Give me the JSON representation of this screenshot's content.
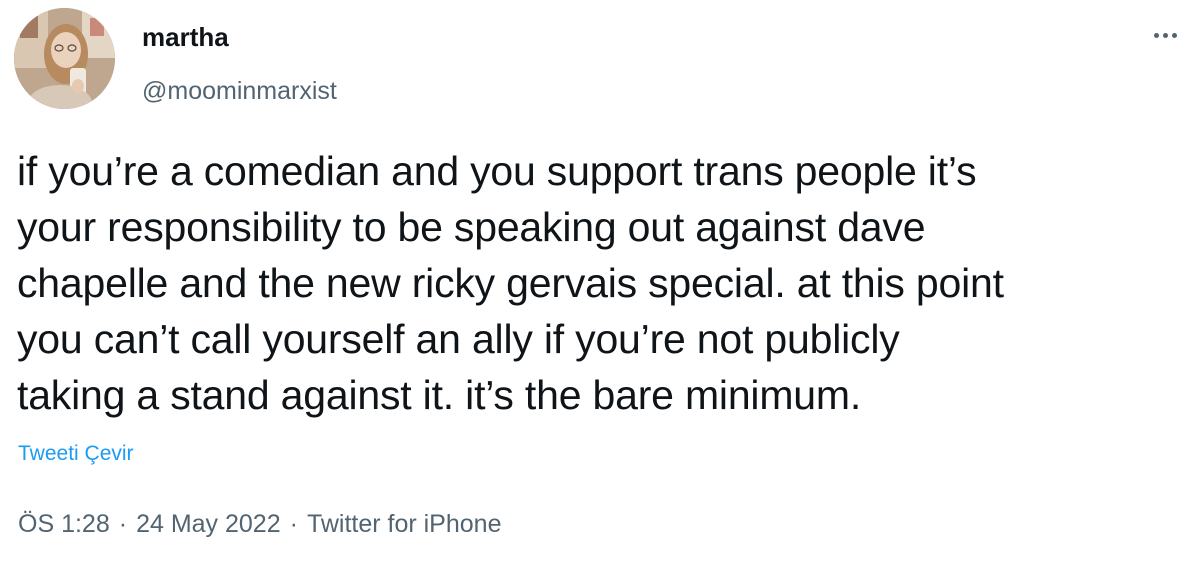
{
  "author": {
    "display_name": "martha",
    "handle": "@moominmarxist"
  },
  "tweet": {
    "lines": [
      "if you’re a comedian and you support trans people it’s",
      "your responsibility to be speaking out against dave",
      "chapelle and the new ricky gervais special. at this point",
      "you can’t call yourself an ally if you’re not publicly",
      "taking a stand against it. it’s the bare minimum."
    ],
    "translate_label": "Tweeti Çevir"
  },
  "meta": {
    "time": "ÖS 1:28",
    "separator": "·",
    "date": "24 May 2022",
    "source": "Twitter for iPhone"
  },
  "icons": {
    "more": "more-horizontal-icon",
    "avatar": "profile-photo"
  },
  "colors": {
    "text": "#0f1419",
    "secondary": "#536471",
    "link": "#1d9bf0",
    "background": "#ffffff"
  }
}
